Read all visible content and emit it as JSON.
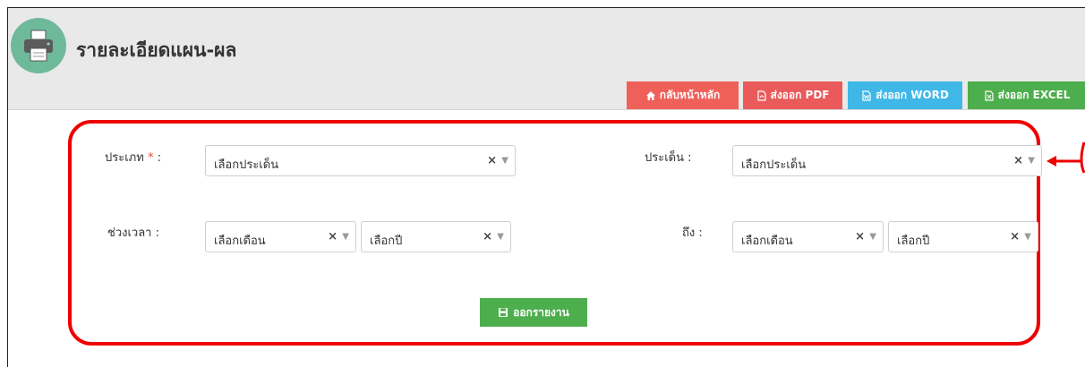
{
  "page": {
    "title": "รายละเอียดแผน-ผล"
  },
  "toolbar": {
    "home_label": "กลับหน้าหลัก",
    "pdf_label": "ส่งออก PDF",
    "word_label": "ส่งออก WORD",
    "excel_label": "ส่งออก EXCEL"
  },
  "form": {
    "type_label": "ประเภท",
    "required_mark": "*",
    "colon": ":",
    "type_placeholder": "เลือกประเด็น",
    "issue_label": "ประเด็น :",
    "issue_placeholder": "เลือกประเด็น",
    "period_label": "ช่วงเวลา :",
    "to_label": "ถึง :",
    "month_placeholder": "เลือกเดือน",
    "year_placeholder": "เลือกปี",
    "clear_glyph": "×",
    "arrow_glyph": "▼",
    "submit_label": "ออกรายงาน"
  },
  "colors": {
    "header_bg": "#e9e9e9",
    "home_btn": "#f0605a",
    "pdf_btn": "#ea5a5a",
    "word_btn": "#3fb8e8",
    "excel_btn": "#4cae4c",
    "highlight_border": "#ee0000",
    "logo_bg": "#6fb99b"
  },
  "icons": [
    "printer-icon",
    "home-icon",
    "pdf-file-icon",
    "word-file-icon",
    "excel-file-icon",
    "save-icon",
    "arrow-left-icon"
  ]
}
